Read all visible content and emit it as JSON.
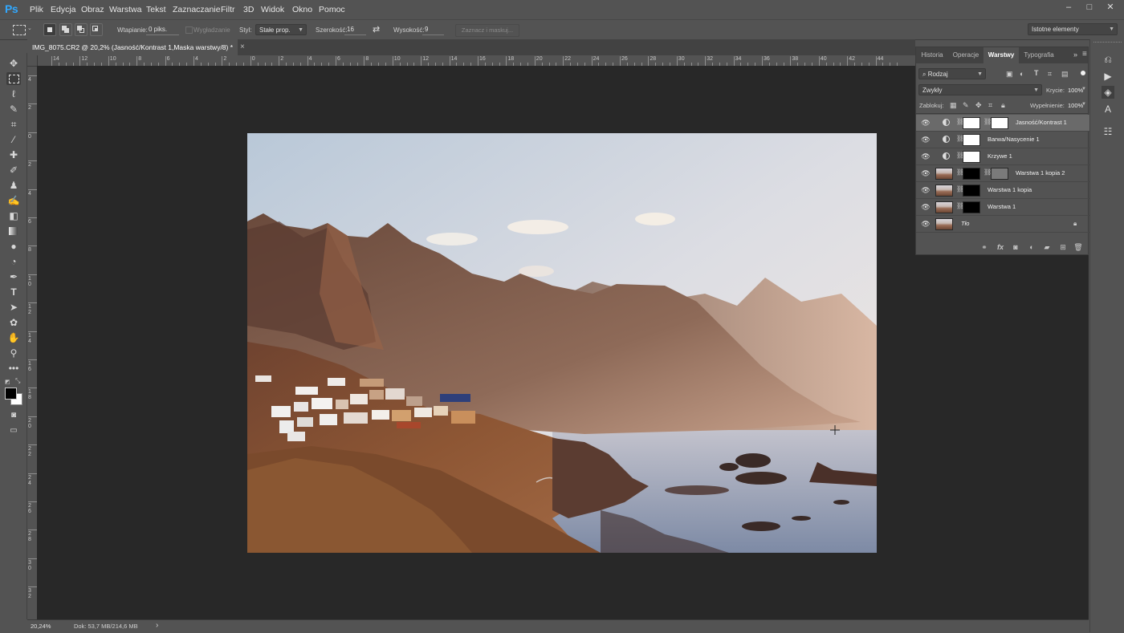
{
  "app": {
    "logo": "Ps"
  },
  "menu": [
    "Plik",
    "Edycja",
    "Obraz",
    "Warstwa",
    "Tekst",
    "Zaznaczanie",
    "Filtr",
    "3D",
    "Widok",
    "Okno",
    "Pomoc"
  ],
  "window_controls": {
    "minimize": "–",
    "maximize": "□",
    "close": "✕"
  },
  "options": {
    "feather_label": "Wtapianie:",
    "feather_value": "0 piks.",
    "antialias_label": "Wygładzanie",
    "style_label": "Styl:",
    "style_value": "Stałe prop.",
    "width_label": "Szerokość:",
    "width_value": "16",
    "swap_icon": "⇄",
    "height_label": "Wysokość:",
    "height_value": "9",
    "select_mask_label": "Zaznacz i maskuj...",
    "workspace": "Istotne elementy"
  },
  "document": {
    "tab_title": "IMG_8075.CR2 @ 20,2% (Jasność/Kontrast 1,Maska warstwy/8) *",
    "close": "×"
  },
  "ruler": {
    "h_numbers": [
      "14",
      "12",
      "10",
      "8",
      "6",
      "4",
      "2",
      "0",
      "2",
      "4",
      "6",
      "8",
      "10",
      "12",
      "14",
      "16",
      "18",
      "20",
      "22",
      "24",
      "26",
      "28",
      "30",
      "32",
      "34",
      "36",
      "38",
      "40",
      "42",
      "44"
    ],
    "v_numbers": [
      "4",
      "2",
      "0",
      "2",
      "4",
      "6",
      "8",
      "1 0",
      "1 2",
      "1 4",
      "1 6",
      "1 8",
      "2 0",
      "2 2",
      "2 4",
      "2 6",
      "2 8",
      "3 0",
      "3 2"
    ]
  },
  "status": {
    "zoom": "20,24%",
    "doc_info": "Dok: 53,7 MB/214,6 MB",
    "arrow": "›"
  },
  "panel": {
    "tabs": [
      "Historia",
      "Operacje",
      "Warstwy",
      "Typografia"
    ],
    "active_tab": "Warstwy",
    "filter_kind": "Rodzaj",
    "blend_mode": "Zwykły",
    "opacity_label": "Krycie:",
    "opacity_value": "100%",
    "lock_label": "Zablokuj:",
    "fill_label": "Wypełnienie:",
    "fill_value": "100%",
    "layers": [
      {
        "name": "Jasność/Kontrast 1",
        "type": "adjustment",
        "thumb": "white",
        "mask": "white",
        "selected": true
      },
      {
        "name": "Barwa/Nasycenie 1",
        "type": "adjustment",
        "thumb": "white",
        "selected": false
      },
      {
        "name": "Krzywe 1",
        "type": "adjustment",
        "thumb": "white",
        "selected": false
      },
      {
        "name": "Warstwa 1 kopia 2",
        "type": "pixel",
        "thumb": "photo",
        "mask": "black",
        "mask2": "grey",
        "selected": false
      },
      {
        "name": "Warstwa 1 kopia",
        "type": "pixel",
        "thumb": "photo",
        "mask": "black",
        "selected": false
      },
      {
        "name": "Warstwa 1",
        "type": "pixel",
        "thumb": "photo",
        "mask": "black",
        "selected": false
      },
      {
        "name": "Tło",
        "type": "background",
        "thumb": "photo",
        "locked": true,
        "selected": false
      }
    ]
  },
  "icons": {
    "tools": [
      "move-icon",
      "marquee-icon",
      "lasso-icon",
      "quick-select-icon",
      "crop-icon",
      "eyedropper-icon",
      "healing-brush-icon",
      "brush-icon",
      "clone-stamp-icon",
      "history-brush-icon",
      "eraser-icon",
      "gradient-icon",
      "blur-icon",
      "dodge-icon",
      "pen-icon",
      "type-icon",
      "path-select-icon",
      "shape-icon",
      "hand-icon",
      "zoom-icon",
      "more-tools-icon"
    ],
    "right_strip": [
      "history-panel-icon",
      "actions-panel-icon",
      "layers-panel-icon",
      "character-panel-icon",
      "libraries-panel-icon"
    ]
  },
  "colors": {
    "accent": "#31a8ff",
    "canvas_bg": "#282828",
    "ui_bg": "#535353"
  }
}
